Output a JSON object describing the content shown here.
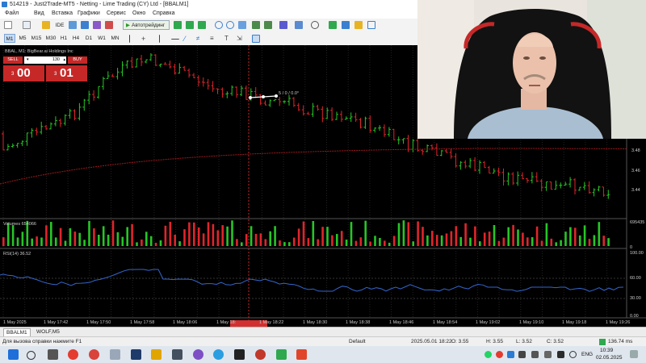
{
  "titlebar": {
    "title": "514219 - Just2Trade-MT5 - Netting - Lime Trading (CY) Ltd - [BBALM1]"
  },
  "menu": [
    "Файл",
    "Вид",
    "Вставка",
    "Графики",
    "Сервис",
    "Окно",
    "Справка"
  ],
  "toolbar": {
    "ide_label": "IDE",
    "autotrade_label": "Автотрейдинг",
    "timeframes": [
      "M1",
      "M5",
      "M15",
      "M30",
      "H1",
      "H4",
      "D1",
      "W1",
      "MN"
    ],
    "selected_timeframe": "M1"
  },
  "chart": {
    "symbol_header": "BBAL, M1:  BigBear.ai Holdings Inc",
    "sell_label": "SELL",
    "buy_label": "BUY",
    "volume": "130",
    "sell_price_small": "3",
    "sell_price_big": "00",
    "buy_price_small": "3",
    "buy_price_big": "01",
    "trendline_label": "5 / 0 / 0.0°",
    "price_axis": [
      "3.48",
      "3.46",
      "3.44"
    ],
    "volume_label": "Volumes 654066",
    "volume_axis": [
      "695435",
      "0"
    ],
    "rsi_label": "RSI(14) 36.52",
    "rsi_axis": [
      "100.00",
      "60.00",
      "30.00",
      "0.00"
    ],
    "time_labels": [
      "1 May 2025",
      "1 May 17:42",
      "1 May 17:50",
      "1 May 17:58",
      "1 May 18:06",
      "1 May 18:",
      "1 May 18:22",
      "1 May 18:30",
      "1 May 18:38",
      "1 May 18:46",
      "1 May 18:54",
      "1 May 19:02",
      "1 May 19:10",
      "1 May 19:18",
      "1 May 19:26"
    ],
    "colors": {
      "up": "#26c626",
      "down": "#e0252b",
      "ma": "#a0191e",
      "rsi": "#3366cc",
      "crosshair": "#c62828"
    }
  },
  "tabs": [
    "BBALM1",
    "WOLF,M5"
  ],
  "active_tab": "BBALM1",
  "status": {
    "help": "Для вызова справки нажмите F1",
    "profile": "Default",
    "datetime": "2025.05.01 18:22",
    "open": "O: 3.55",
    "high": "H: 3.55",
    "low": "L: 3.52",
    "close": "C: 3.52",
    "ping": "136.74 ms"
  },
  "taskbar": {
    "lang": "ENG",
    "time": "10:39",
    "date": "02.05.2025"
  }
}
